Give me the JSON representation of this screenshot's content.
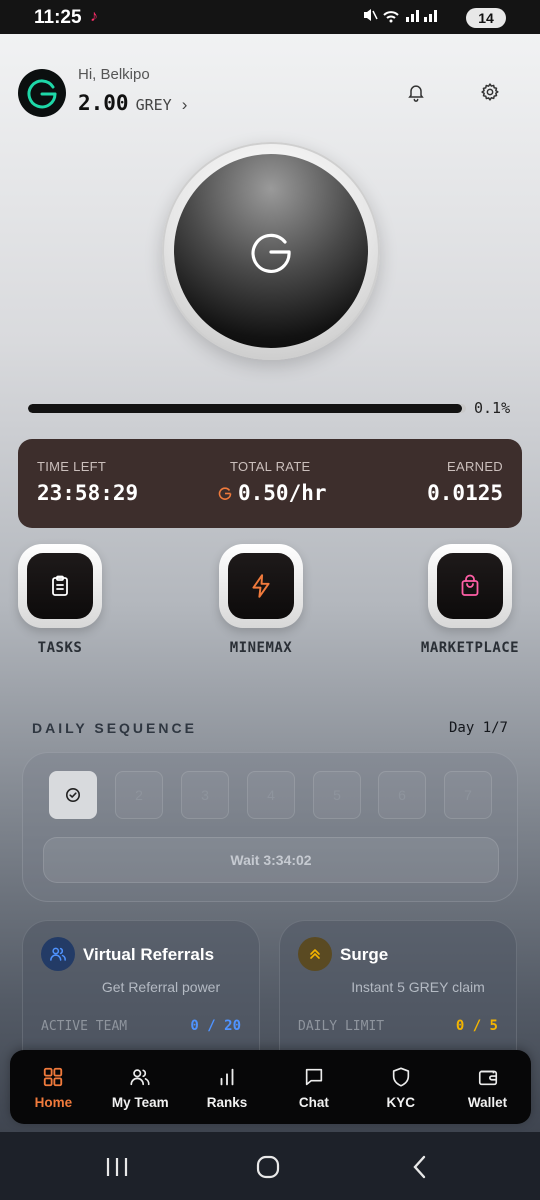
{
  "status_bar": {
    "time": "11:25",
    "app_icon": "tiktok-icon",
    "system_icons": "mute wifi signal signal",
    "battery": "14"
  },
  "header": {
    "greeting": "Hi, Belkipo",
    "balance": "2.00",
    "unit": "GREY",
    "chevron": "›"
  },
  "mining": {
    "progress_text": "0.1%",
    "progress_value": 0.001
  },
  "stats": {
    "time_left_label": "TIME LEFT",
    "time_left": "23:58:29",
    "rate_label": "TOTAL RATE",
    "rate": "0.50/hr",
    "earned_label": "EARNED",
    "earned": "0.0125"
  },
  "actions": [
    {
      "label": "TASKS",
      "icon": "clipboard-icon"
    },
    {
      "label": "MINEMAX",
      "icon": "lightning-icon"
    },
    {
      "label": "MARKETPLACE",
      "icon": "shopping-bag-icon"
    }
  ],
  "daily": {
    "title": "DAILY SEQUENCE",
    "day": "Day 1/7",
    "days": [
      "2",
      "3",
      "4",
      "5",
      "6",
      "7"
    ],
    "wait": "Wait 3:34:02"
  },
  "referrals": {
    "title": "Virtual Referrals",
    "subtitle": "Get Referral power",
    "limit_label": "ACTIVE TEAM",
    "limit_value": "0 / 20"
  },
  "surge": {
    "title": "Surge",
    "subtitle": "Instant 5 GREY claim",
    "limit_label": "DAILY LIMIT",
    "limit_value": "0 / 5"
  },
  "nav": {
    "home": "Home",
    "team": "My Team",
    "ranks": "Ranks",
    "chat": "Chat",
    "kyc": "KYC",
    "wallet": "Wallet"
  },
  "colors": {
    "accent": "#f07a3c",
    "stats_bg": "#3d2e2c",
    "referral_blue": "#4f93ff",
    "surge_yellow": "#f3b400"
  }
}
